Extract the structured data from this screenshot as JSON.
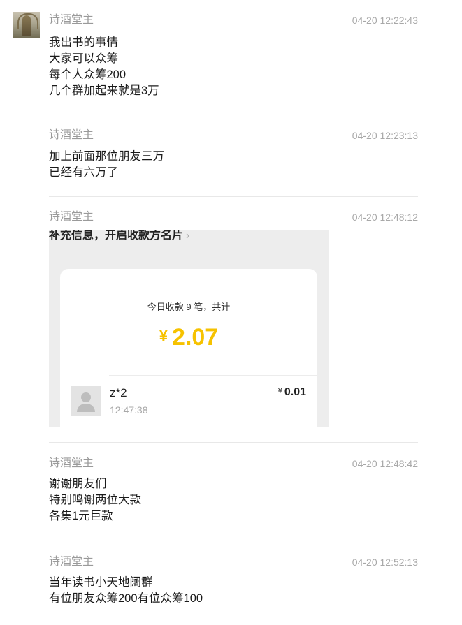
{
  "messages": [
    {
      "sender": "诗酒堂主",
      "time": "04-20 12:22:43",
      "lines": [
        "我出书的事情",
        "大家可以众筹",
        "每个人众筹200",
        "几个群加起来就是3万"
      ]
    },
    {
      "sender": "诗酒堂主",
      "time": "04-20 12:23:13",
      "lines": [
        "加上前面那位朋友三万",
        "已经有六万了"
      ]
    },
    {
      "sender": "诗酒堂主",
      "time": "04-20 12:48:12",
      "image": {
        "header": "补充信息，开启收款方名片",
        "header_chevron": "›",
        "today_label": "今日收款 9 笔，共计",
        "currency": "¥",
        "total": "2.07",
        "payer_name": "z*2",
        "payer_time": "12:47:38",
        "payer_amount": "0.01",
        "accent_color": "#f6c200"
      }
    },
    {
      "sender": "诗酒堂主",
      "time": "04-20 12:48:42",
      "lines": [
        "谢谢朋友们",
        "特别鸣谢两位大款",
        "各集1元巨款"
      ]
    },
    {
      "sender": "诗酒堂主",
      "time": "04-20 12:52:13",
      "lines": [
        "当年读书小天地阔群",
        "有位朋友众筹200有位众筹100"
      ]
    }
  ]
}
